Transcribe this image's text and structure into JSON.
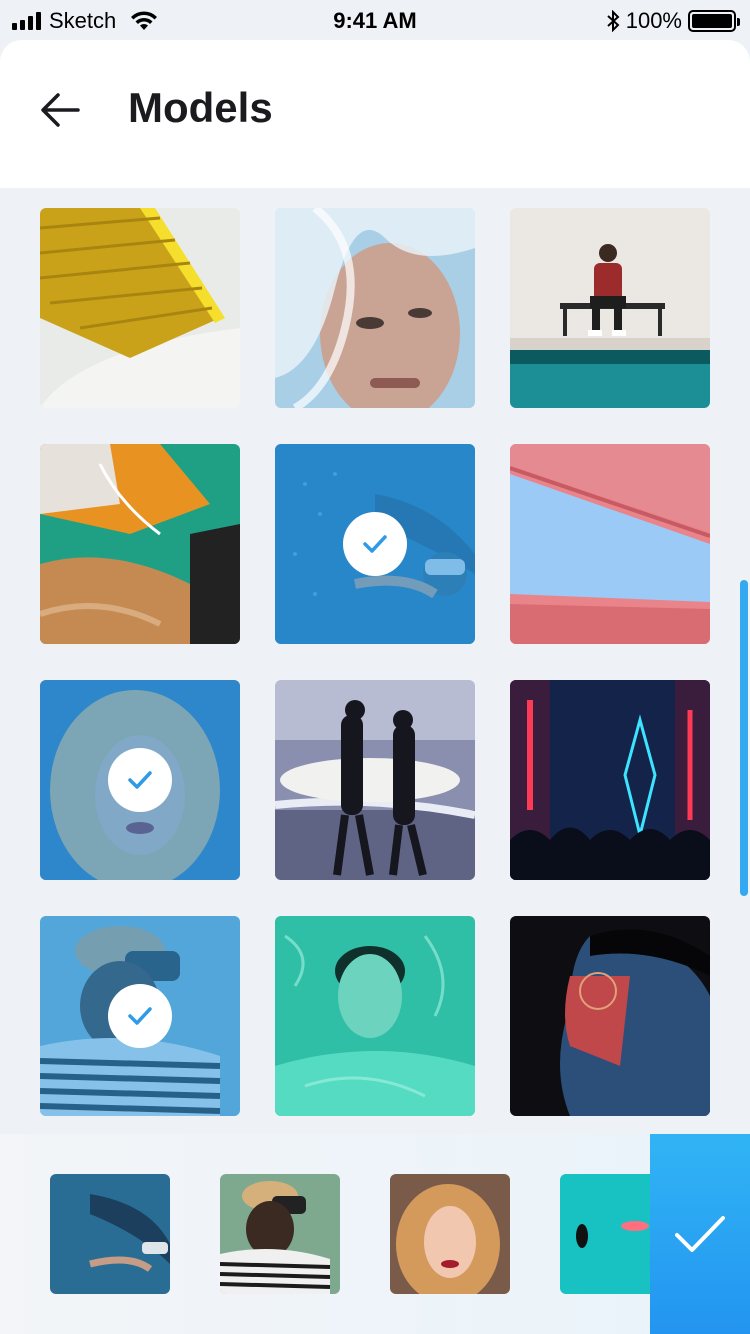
{
  "status": {
    "carrier": "Sketch",
    "time": "9:41 AM",
    "battery": "100%"
  },
  "header": {
    "title": "Models",
    "back_icon": "arrow-left-icon"
  },
  "grid": {
    "tiles": [
      {
        "name": "yellow-stairs",
        "selected": false
      },
      {
        "name": "underwater-veil-face",
        "selected": false
      },
      {
        "name": "man-on-bench-pool",
        "selected": false
      },
      {
        "name": "swimmer-orange-suit",
        "selected": false
      },
      {
        "name": "underwater-diver",
        "selected": true
      },
      {
        "name": "pink-wall-sky",
        "selected": false
      },
      {
        "name": "blonde-woman",
        "selected": true
      },
      {
        "name": "surfers-beach",
        "selected": false
      },
      {
        "name": "neon-concert",
        "selected": false
      },
      {
        "name": "woman-vr-headset",
        "selected": true
      },
      {
        "name": "man-water-reflection",
        "selected": false
      },
      {
        "name": "man-red-light-glasses",
        "selected": false
      }
    ]
  },
  "tray": {
    "items": [
      {
        "name": "underwater-diver"
      },
      {
        "name": "woman-vr-headset"
      },
      {
        "name": "blonde-woman"
      },
      {
        "name": "aerial-pool-swimmers"
      }
    ],
    "confirm_icon": "checkmark-icon"
  },
  "colors": {
    "accent": "#2f9ae6",
    "confirm": "#2395f0",
    "background": "#eef2f6"
  }
}
